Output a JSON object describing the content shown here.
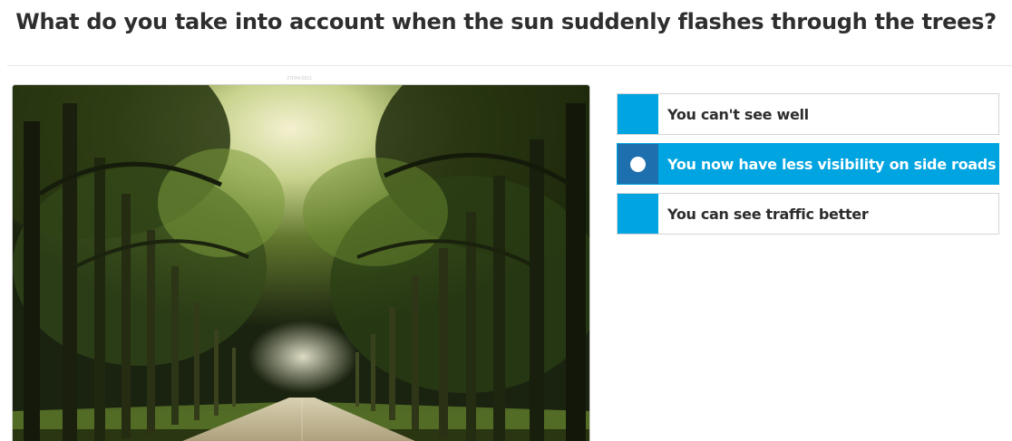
{
  "question": {
    "text": "What do you take into account when the sun suddenly flashes through the trees?"
  },
  "image": {
    "caption": "27FH4.0021"
  },
  "answers": [
    {
      "label": "You can't see well",
      "selected": false
    },
    {
      "label": "You now have less visibility on side roads",
      "selected": true
    },
    {
      "label": "You can see traffic better",
      "selected": false
    }
  ],
  "colors": {
    "accent": "#00a4e0",
    "selected_marker": "#1e6fad"
  }
}
